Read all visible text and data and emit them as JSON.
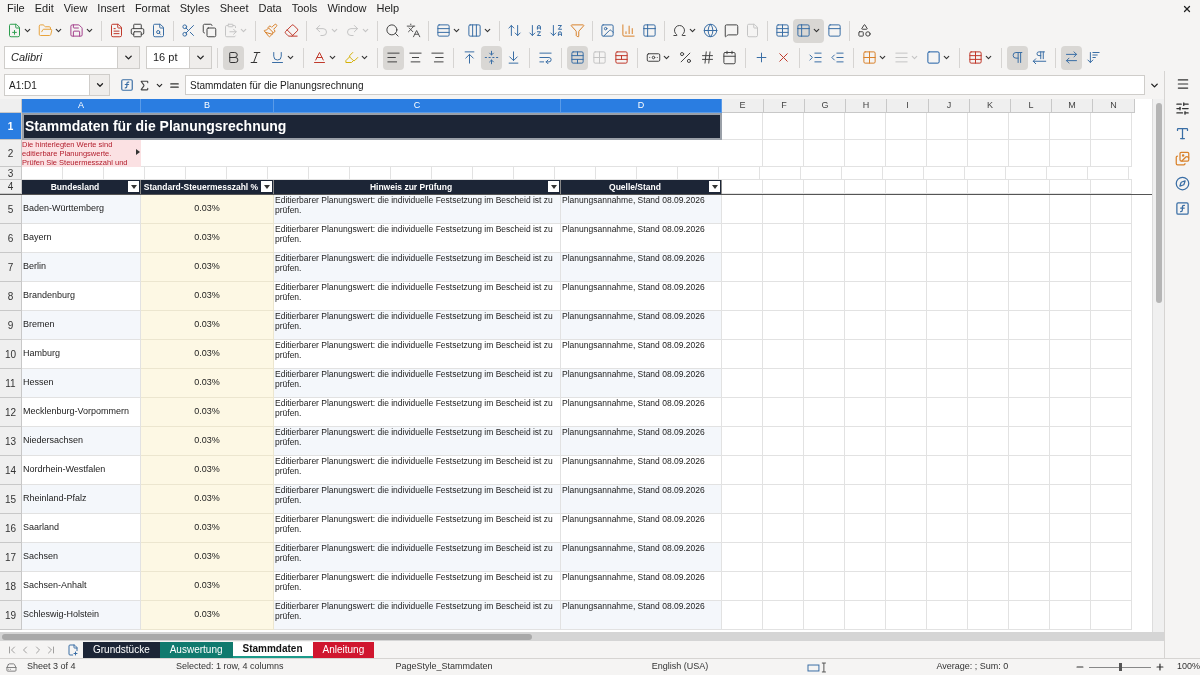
{
  "menu": [
    "File",
    "Edit",
    "View",
    "Insert",
    "Format",
    "Styles",
    "Sheet",
    "Data",
    "Tools",
    "Window",
    "Help"
  ],
  "standard_bar": [
    [
      {
        "kind": "new",
        "dropdown": true,
        "disabled": false,
        "pressed": false
      },
      {
        "kind": "open",
        "dropdown": true,
        "disabled": false,
        "pressed": false
      },
      {
        "kind": "save",
        "dropdown": true,
        "disabled": false,
        "pressed": false
      }
    ],
    [
      {
        "kind": "pdf",
        "dropdown": false,
        "disabled": false,
        "pressed": false
      },
      {
        "kind": "print",
        "dropdown": false,
        "disabled": false,
        "pressed": false
      },
      {
        "kind": "preview",
        "dropdown": false,
        "disabled": false,
        "pressed": false
      }
    ],
    [
      {
        "kind": "cut",
        "dropdown": false,
        "disabled": false,
        "pressed": false
      },
      {
        "kind": "copy",
        "dropdown": false,
        "disabled": false,
        "pressed": false
      },
      {
        "kind": "paste",
        "dropdown": true,
        "disabled": true,
        "pressed": false
      }
    ],
    [
      {
        "kind": "clone",
        "dropdown": false,
        "disabled": false,
        "pressed": false
      },
      {
        "kind": "clear",
        "dropdown": false,
        "disabled": false,
        "pressed": false
      }
    ],
    [
      {
        "kind": "undo",
        "dropdown": true,
        "disabled": true,
        "pressed": false
      },
      {
        "kind": "redo",
        "dropdown": true,
        "disabled": true,
        "pressed": false
      }
    ],
    [
      {
        "kind": "find",
        "dropdown": false,
        "disabled": false,
        "pressed": false
      },
      {
        "kind": "spelling",
        "dropdown": false,
        "disabled": false,
        "pressed": false
      }
    ],
    [
      {
        "kind": "row",
        "dropdown": true,
        "disabled": false,
        "pressed": false
      },
      {
        "kind": "column",
        "dropdown": true,
        "disabled": false,
        "pressed": false
      }
    ],
    [
      {
        "kind": "sort",
        "dropdown": false,
        "disabled": false,
        "pressed": false
      },
      {
        "kind": "sort-asc",
        "dropdown": false,
        "disabled": false,
        "pressed": false
      },
      {
        "kind": "sort-desc",
        "dropdown": false,
        "disabled": false,
        "pressed": false
      },
      {
        "kind": "filter",
        "dropdown": false,
        "disabled": false,
        "pressed": false
      }
    ],
    [
      {
        "kind": "image",
        "dropdown": false,
        "disabled": false,
        "pressed": false
      },
      {
        "kind": "chart",
        "dropdown": false,
        "disabled": false,
        "pressed": false
      },
      {
        "kind": "pivot",
        "dropdown": false,
        "disabled": false,
        "pressed": false
      }
    ],
    [
      {
        "kind": "special",
        "dropdown": true,
        "disabled": false,
        "pressed": false
      },
      {
        "kind": "link",
        "dropdown": false,
        "disabled": false,
        "pressed": false
      },
      {
        "kind": "comment",
        "dropdown": false,
        "disabled": false,
        "pressed": false
      },
      {
        "kind": "header",
        "dropdown": false,
        "disabled": true,
        "pressed": false
      }
    ],
    [
      {
        "kind": "print-range",
        "dropdown": false,
        "disabled": false,
        "pressed": false
      },
      {
        "kind": "freeze",
        "dropdown": true,
        "disabled": false,
        "pressed": true
      },
      {
        "kind": "split",
        "dropdown": false,
        "disabled": false,
        "pressed": false
      }
    ],
    [
      {
        "kind": "shapes",
        "dropdown": false,
        "disabled": false,
        "pressed": false
      }
    ]
  ],
  "formatting_bar": {
    "font_name": "Calibri",
    "font_size": "16 pt",
    "groups": [
      [
        {
          "kind": "bold",
          "dropdown": false,
          "disabled": false,
          "pressed": true
        },
        {
          "kind": "italic",
          "dropdown": false,
          "disabled": false,
          "pressed": false
        },
        {
          "kind": "underline",
          "dropdown": true,
          "disabled": false,
          "pressed": false
        }
      ],
      [
        {
          "kind": "font-color",
          "dropdown": true,
          "disabled": false,
          "pressed": false
        },
        {
          "kind": "highlight",
          "dropdown": true,
          "disabled": false,
          "pressed": false
        }
      ],
      [
        {
          "kind": "align-left",
          "dropdown": false,
          "disabled": false,
          "pressed": true
        },
        {
          "kind": "align-center",
          "dropdown": false,
          "disabled": false,
          "pressed": false
        },
        {
          "kind": "align-right",
          "dropdown": false,
          "disabled": false,
          "pressed": false
        }
      ],
      [
        {
          "kind": "align-top",
          "dropdown": false,
          "disabled": false,
          "pressed": false
        },
        {
          "kind": "align-middle",
          "dropdown": false,
          "disabled": false,
          "pressed": true
        },
        {
          "kind": "align-bottom",
          "dropdown": false,
          "disabled": false,
          "pressed": false
        }
      ],
      [
        {
          "kind": "wrap",
          "dropdown": false,
          "disabled": false,
          "pressed": false
        }
      ],
      [
        {
          "kind": "merge-center",
          "dropdown": false,
          "disabled": false,
          "pressed": true
        },
        {
          "kind": "merge",
          "dropdown": false,
          "disabled": true,
          "pressed": false
        },
        {
          "kind": "unmerge",
          "dropdown": false,
          "disabled": false,
          "pressed": false
        }
      ],
      [
        {
          "kind": "currency",
          "dropdown": true,
          "disabled": false,
          "pressed": false
        },
        {
          "kind": "percent",
          "dropdown": false,
          "disabled": false,
          "pressed": false
        },
        {
          "kind": "number",
          "dropdown": false,
          "disabled": false,
          "pressed": false
        },
        {
          "kind": "date",
          "dropdown": false,
          "disabled": false,
          "pressed": false
        }
      ],
      [
        {
          "kind": "add-decimal",
          "dropdown": false,
          "disabled": false,
          "pressed": false
        },
        {
          "kind": "del-decimal",
          "dropdown": false,
          "disabled": false,
          "pressed": false
        }
      ],
      [
        {
          "kind": "indent-more",
          "dropdown": false,
          "disabled": false,
          "pressed": false
        },
        {
          "kind": "indent-less",
          "dropdown": false,
          "disabled": false,
          "pressed": false
        }
      ],
      [
        {
          "kind": "borders",
          "dropdown": true,
          "disabled": false,
          "pressed": false
        },
        {
          "kind": "border-style",
          "dropdown": true,
          "disabled": true,
          "pressed": false
        },
        {
          "kind": "border-color",
          "dropdown": true,
          "disabled": false,
          "pressed": false
        }
      ],
      [
        {
          "kind": "conditional",
          "dropdown": true,
          "disabled": false,
          "pressed": false
        }
      ],
      [
        {
          "kind": "ltr",
          "dropdown": false,
          "disabled": false,
          "pressed": true
        },
        {
          "kind": "rtl",
          "dropdown": false,
          "disabled": false,
          "pressed": false
        }
      ],
      [
        {
          "kind": "text-ltr",
          "dropdown": false,
          "disabled": false,
          "pressed": true
        },
        {
          "kind": "text-ttb",
          "dropdown": false,
          "disabled": false,
          "pressed": false
        }
      ]
    ]
  },
  "name_box": "A1:D1",
  "formula": "Stammdaten für die Planungsrechnung",
  "columns": [
    {
      "label": "A",
      "selected": true
    },
    {
      "label": "B",
      "selected": true
    },
    {
      "label": "C",
      "selected": true
    },
    {
      "label": "D",
      "selected": true
    },
    {
      "label": "E",
      "selected": false
    },
    {
      "label": "F",
      "selected": false
    },
    {
      "label": "G",
      "selected": false
    },
    {
      "label": "H",
      "selected": false
    },
    {
      "label": "I",
      "selected": false
    },
    {
      "label": "J",
      "selected": false
    },
    {
      "label": "K",
      "selected": false
    },
    {
      "label": "L",
      "selected": false
    },
    {
      "label": "M",
      "selected": false
    },
    {
      "label": "N",
      "selected": false
    }
  ],
  "title_row": {
    "row": "1",
    "selected": true,
    "text": "Stammdaten für die Planungsrechnung"
  },
  "note_row": {
    "row": "2",
    "selected": false,
    "text": "Die hinterlegten Werte sind editierbare Planungswerte. Prüfen Sie Steuermesszahl und"
  },
  "empty_row": {
    "row": "3",
    "selected": false
  },
  "header_row": {
    "row": "4",
    "selected": false,
    "cells": [
      "Bundesland",
      "Standard-Steuermesszahl %",
      "Hinweis zur Prüfung",
      "Quelle/Stand"
    ]
  },
  "rows": [
    {
      "row": "5",
      "selected": false,
      "state": "Baden-Württemberg",
      "rate": "0.03%",
      "hint": "Editierbarer Planungswert: die individuelle Festsetzung im Bescheid ist zu prüfen.",
      "source": "Planungsannahme, Stand 08.09.2026"
    },
    {
      "row": "6",
      "selected": false,
      "state": "Bayern",
      "rate": "0.03%",
      "hint": "Editierbarer Planungswert: die individuelle Festsetzung im Bescheid ist zu prüfen.",
      "source": "Planungsannahme, Stand 08.09.2026"
    },
    {
      "row": "7",
      "selected": false,
      "state": "Berlin",
      "rate": "0.03%",
      "hint": "Editierbarer Planungswert: die individuelle Festsetzung im Bescheid ist zu prüfen.",
      "source": "Planungsannahme, Stand 08.09.2026"
    },
    {
      "row": "8",
      "selected": false,
      "state": "Brandenburg",
      "rate": "0.03%",
      "hint": "Editierbarer Planungswert: die individuelle Festsetzung im Bescheid ist zu prüfen.",
      "source": "Planungsannahme, Stand 08.09.2026"
    },
    {
      "row": "9",
      "selected": false,
      "state": "Bremen",
      "rate": "0.03%",
      "hint": "Editierbarer Planungswert: die individuelle Festsetzung im Bescheid ist zu prüfen.",
      "source": "Planungsannahme, Stand 08.09.2026"
    },
    {
      "row": "10",
      "selected": false,
      "state": "Hamburg",
      "rate": "0.03%",
      "hint": "Editierbarer Planungswert: die individuelle Festsetzung im Bescheid ist zu prüfen.",
      "source": "Planungsannahme, Stand 08.09.2026"
    },
    {
      "row": "11",
      "selected": false,
      "state": "Hessen",
      "rate": "0.03%",
      "hint": "Editierbarer Planungswert: die individuelle Festsetzung im Bescheid ist zu prüfen.",
      "source": "Planungsannahme, Stand 08.09.2026"
    },
    {
      "row": "12",
      "selected": false,
      "state": "Mecklenburg-Vorpommern",
      "rate": "0.03%",
      "hint": "Editierbarer Planungswert: die individuelle Festsetzung im Bescheid ist zu prüfen.",
      "source": "Planungsannahme, Stand 08.09.2026"
    },
    {
      "row": "13",
      "selected": false,
      "state": "Niedersachsen",
      "rate": "0.03%",
      "hint": "Editierbarer Planungswert: die individuelle Festsetzung im Bescheid ist zu prüfen.",
      "source": "Planungsannahme, Stand 08.09.2026"
    },
    {
      "row": "14",
      "selected": false,
      "state": "Nordrhein-Westfalen",
      "rate": "0.03%",
      "hint": "Editierbarer Planungswert: die individuelle Festsetzung im Bescheid ist zu prüfen.",
      "source": "Planungsannahme, Stand 08.09.2026"
    },
    {
      "row": "15",
      "selected": false,
      "state": "Rheinland-Pfalz",
      "rate": "0.03%",
      "hint": "Editierbarer Planungswert: die individuelle Festsetzung im Bescheid ist zu prüfen.",
      "source": "Planungsannahme, Stand 08.09.2026"
    },
    {
      "row": "16",
      "selected": false,
      "state": "Saarland",
      "rate": "0.03%",
      "hint": "Editierbarer Planungswert: die individuelle Festsetzung im Bescheid ist zu prüfen.",
      "source": "Planungsannahme, Stand 08.09.2026"
    },
    {
      "row": "17",
      "selected": false,
      "state": "Sachsen",
      "rate": "0.03%",
      "hint": "Editierbarer Planungswert: die individuelle Festsetzung im Bescheid ist zu prüfen.",
      "source": "Planungsannahme, Stand 08.09.2026"
    },
    {
      "row": "18",
      "selected": false,
      "state": "Sachsen-Anhalt",
      "rate": "0.03%",
      "hint": "Editierbarer Planungswert: die individuelle Festsetzung im Bescheid ist zu prüfen.",
      "source": "Planungsannahme, Stand 08.09.2026"
    },
    {
      "row": "19",
      "selected": false,
      "state": "Schleswig-Holstein",
      "rate": "0.03%",
      "hint": "Editierbarer Planungswert: die individuelle Festsetzung im Bescheid ist zu prüfen.",
      "source": "Planungsannahme, Stand 08.09.2026"
    }
  ],
  "sheet_tabs": [
    {
      "label": "Grundstücke",
      "color": "#1c2536",
      "selected": false
    },
    {
      "label": "Auswertung",
      "color": "#107a6e",
      "selected": false
    },
    {
      "label": "Stammdaten",
      "color": "#1c9a8a",
      "selected": true
    },
    {
      "label": "Anleitung",
      "color": "#d0162e",
      "selected": false
    }
  ],
  "status_bar": {
    "sheet": "Sheet 3 of 4",
    "selection": "Selected: 1 row, 4 columns",
    "page_style": "PageStyle_Stammdaten",
    "language": "English (USA)",
    "summary": "Average: ; Sum: 0",
    "zoom": "100%",
    "zoom_slider": {
      "level": 0.5
    }
  }
}
